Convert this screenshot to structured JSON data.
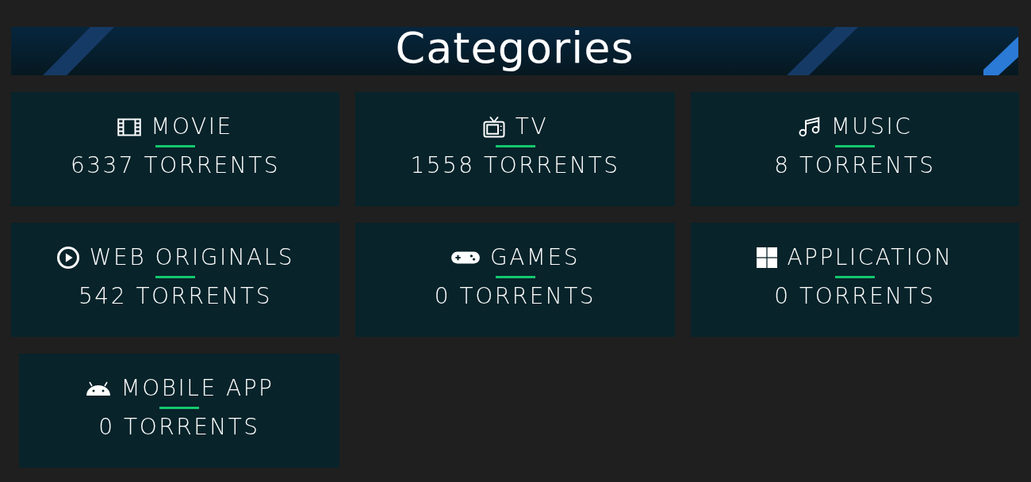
{
  "header": {
    "title": "Categories"
  },
  "categories": [
    {
      "kind": "film",
      "name": "MOVIE",
      "count": "6337 TORRENTS"
    },
    {
      "kind": "tv",
      "name": "TV",
      "count": "1558 TORRENTS"
    },
    {
      "kind": "music",
      "name": "MUSIC",
      "count": "8 TORRENTS"
    },
    {
      "kind": "play",
      "name": "WEB ORIGINALS",
      "count": "542 TORRENTS"
    },
    {
      "kind": "gamepad",
      "name": "GAMES",
      "count": "0 TORRENTS"
    },
    {
      "kind": "windows",
      "name": "APPLICATION",
      "count": "0 TORRENTS"
    },
    {
      "kind": "android",
      "name": "MOBILE APP",
      "count": "0 TORRENTS"
    }
  ]
}
